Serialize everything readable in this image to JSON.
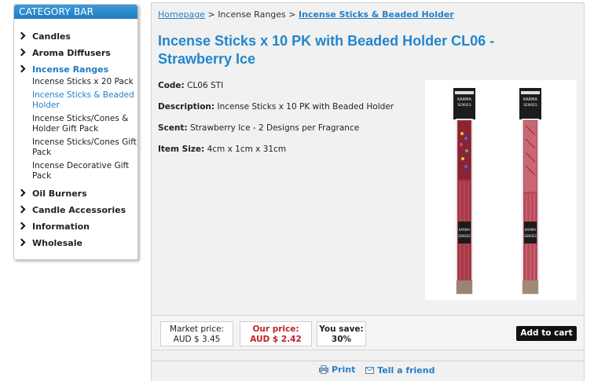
{
  "sidebar": {
    "title": "CATEGORY BAR",
    "items": [
      {
        "label": "Candles"
      },
      {
        "label": "Aroma Diffusers"
      },
      {
        "label": "Incense Ranges",
        "active": true,
        "children": [
          {
            "label": "Incense Sticks x 20 Pack"
          },
          {
            "label": "Incense Sticks & Beaded Holder",
            "active": true
          },
          {
            "label": "Incense Sticks/Cones & Holder Gift Pack"
          },
          {
            "label": "Incense Sticks/Cones Gift Pack"
          },
          {
            "label": "Incense Decorative Gift Pack"
          }
        ]
      },
      {
        "label": "Oil Burners"
      },
      {
        "label": "Candle Accessories"
      },
      {
        "label": "Information"
      },
      {
        "label": "Wholesale"
      }
    ]
  },
  "breadcrumb": {
    "home": "Homepage",
    "sep": ">",
    "middle": "Incense Ranges",
    "current": "Incense Sticks & Beaded Holder"
  },
  "product": {
    "title": "Incense Sticks x 10 PK with Beaded Holder CL06 - Strawberry Ice",
    "code_label": "Code:",
    "code_value": "CL06 STI",
    "description_label": "Description:",
    "description_value": "Incense Sticks x 10 PK with Beaded Holder",
    "scent_label": "Scent:",
    "scent_value": "Strawberry Ice - 2 Designs per Fragrance",
    "size_label": "Item Size:",
    "size_value": "4cm x 1cm x 31cm",
    "brand_label": "KARMA SENSES"
  },
  "pricing": {
    "market_label": "Market price:",
    "market_value": "AUD $ 3.45",
    "our_label": "Our price:",
    "our_value": "AUD $ 2.42",
    "save_label": "You save:",
    "save_value": "30%",
    "add_to_cart": "Add to cart"
  },
  "actions": {
    "print": "Print",
    "tell_friend": "Tell a friend"
  },
  "colors": {
    "accent": "#2286cc",
    "header_bg": "#1f7cc2",
    "price_red": "#c0232a",
    "button_bg": "#111111"
  }
}
